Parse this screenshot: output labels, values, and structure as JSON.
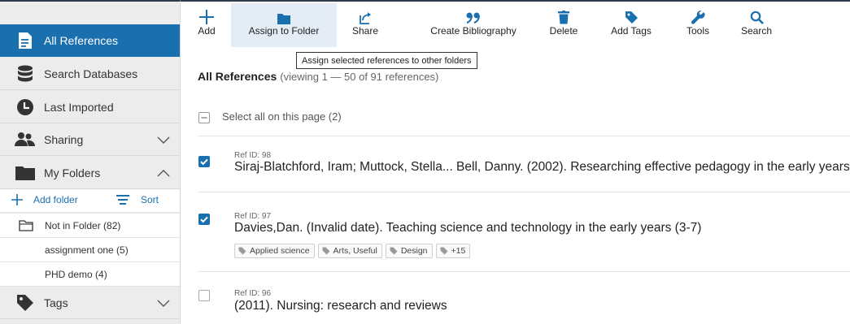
{
  "sidebar": {
    "items": [
      {
        "label": "All References",
        "icon": "document-icon"
      },
      {
        "label": "Search Databases",
        "icon": "database-icon"
      },
      {
        "label": "Last Imported",
        "icon": "clock-icon"
      },
      {
        "label": "Sharing",
        "icon": "users-icon"
      },
      {
        "label": "My Folders",
        "icon": "folder-icon"
      },
      {
        "label": "Tags",
        "icon": "tag-icon"
      }
    ],
    "add_folder_label": "Add folder",
    "sort_label": "Sort",
    "folders": [
      {
        "label": "Not in Folder (82)"
      },
      {
        "label": "assignment one (5)"
      },
      {
        "label": "PHD demo (4)"
      }
    ]
  },
  "toolbar": {
    "buttons": [
      {
        "label": "Add",
        "icon": "plus-icon"
      },
      {
        "label": "Assign to Folder",
        "icon": "folder-icon"
      },
      {
        "label": "Share",
        "icon": "share-icon"
      },
      {
        "label": "Create Bibliography",
        "icon": "quote-icon"
      },
      {
        "label": "Delete",
        "icon": "trash-icon"
      },
      {
        "label": "Add Tags",
        "icon": "tag-icon"
      },
      {
        "label": "Tools",
        "icon": "wrench-icon"
      },
      {
        "label": "Search",
        "icon": "search-icon"
      }
    ],
    "tooltip": "Assign selected references to other folders"
  },
  "main": {
    "title": "All References",
    "subtitle": "(viewing 1 — 50 of 91 references)",
    "select_all_label": "Select all on this page (2)",
    "references": [
      {
        "ref_id": "Ref ID: 98",
        "text": "Siraj-Blatchford, Iram; Muttock, Stella... Bell, Danny. (2002). Researching effective pedagogy in the early years",
        "checked": true,
        "tags": []
      },
      {
        "ref_id": "Ref ID: 97",
        "text": "Davies,Dan. (Invalid date). Teaching science and technology in the early years (3-7)",
        "checked": true,
        "tags": [
          "Applied science",
          "Arts, Useful",
          "Design",
          "+15"
        ]
      },
      {
        "ref_id": "Ref ID: 96",
        "text": "(2011). Nursing: research and reviews",
        "checked": false,
        "tags": []
      }
    ]
  },
  "colors": {
    "accent": "#1a6faf",
    "sidebar_bg": "#ececec",
    "hover_bg": "#e4edf6"
  }
}
